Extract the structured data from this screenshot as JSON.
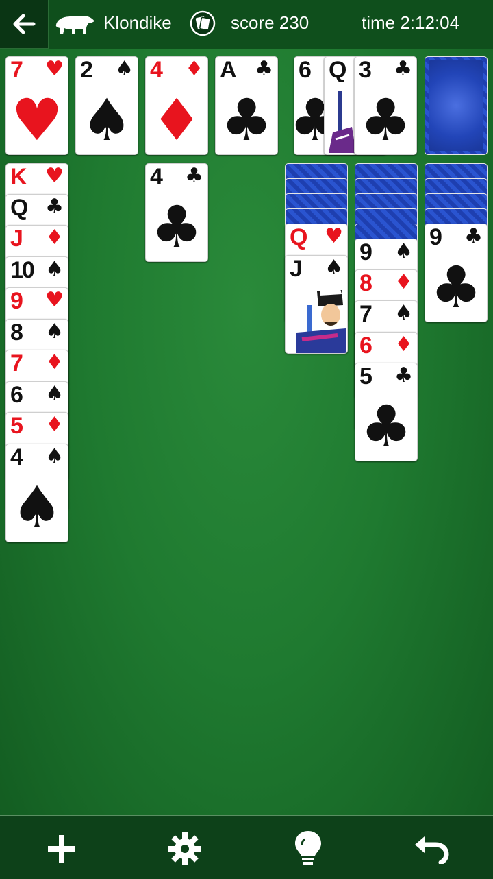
{
  "header": {
    "game_name": "Klondike",
    "score_text": "score 230",
    "time_text": "time 2:12:04"
  },
  "foundations": [
    {
      "rank": "7",
      "suit": "♥",
      "color": "red"
    },
    {
      "rank": "2",
      "suit": "♠",
      "color": "black"
    },
    {
      "rank": "4",
      "suit": "♦",
      "color": "red"
    },
    {
      "rank": "A",
      "suit": "♣",
      "color": "black"
    }
  ],
  "waste": [
    {
      "rank": "6",
      "suit": "♣",
      "color": "black"
    },
    {
      "rank": "Q",
      "suit": "♠",
      "color": "black"
    },
    {
      "rank": "3",
      "suit": "♣",
      "color": "black"
    }
  ],
  "tableau": [
    {
      "face_down": 0,
      "cards": [
        {
          "rank": "K",
          "suit": "♥",
          "color": "red"
        },
        {
          "rank": "Q",
          "suit": "♣",
          "color": "black"
        },
        {
          "rank": "J",
          "suit": "♦",
          "color": "red"
        },
        {
          "rank": "10",
          "suit": "♠",
          "color": "black"
        },
        {
          "rank": "9",
          "suit": "♥",
          "color": "red"
        },
        {
          "rank": "8",
          "suit": "♠",
          "color": "black"
        },
        {
          "rank": "7",
          "suit": "♦",
          "color": "red"
        },
        {
          "rank": "6",
          "suit": "♠",
          "color": "black"
        },
        {
          "rank": "5",
          "suit": "♦",
          "color": "red"
        },
        {
          "rank": "4",
          "suit": "♠",
          "color": "black"
        }
      ]
    },
    {
      "face_down": 0,
      "cards": []
    },
    {
      "face_down": 0,
      "cards": [
        {
          "rank": "4",
          "suit": "♣",
          "color": "black"
        }
      ]
    },
    {
      "face_down": 0,
      "cards": []
    },
    {
      "face_down": 4,
      "cards": [
        {
          "rank": "Q",
          "suit": "♥",
          "color": "red"
        },
        {
          "rank": "J",
          "suit": "♠",
          "color": "black"
        }
      ]
    },
    {
      "face_down": 5,
      "cards": [
        {
          "rank": "9",
          "suit": "♠",
          "color": "black"
        },
        {
          "rank": "8",
          "suit": "♦",
          "color": "red"
        },
        {
          "rank": "7",
          "suit": "♠",
          "color": "black"
        },
        {
          "rank": "6",
          "suit": "♦",
          "color": "red"
        },
        {
          "rank": "5",
          "suit": "♣",
          "color": "black"
        }
      ]
    },
    {
      "face_down": 4,
      "cards": [
        {
          "rank": "9",
          "suit": "♣",
          "color": "black"
        }
      ]
    }
  ],
  "colors": {
    "felt": "#1f7a30",
    "card_red": "#e8141e",
    "card_back": "#2245b8"
  },
  "icons": {
    "back": "arrow-left-icon",
    "bear": "polar-bear-icon",
    "badge": "card-badge-icon",
    "new": "plus-icon",
    "settings": "gear-icon",
    "hint": "lightbulb-icon",
    "undo": "undo-icon"
  }
}
